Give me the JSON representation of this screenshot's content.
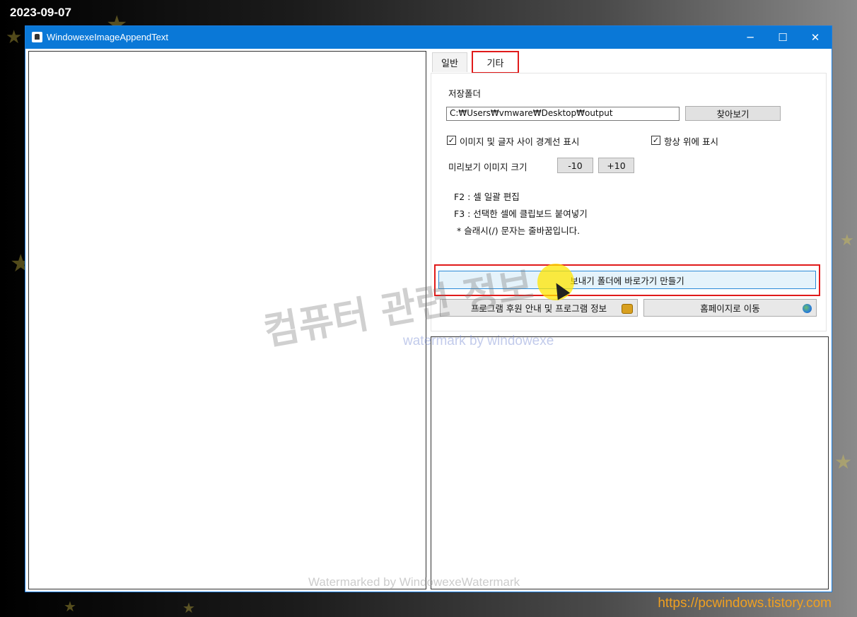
{
  "capture": {
    "date": "2023-09-07",
    "site": "https://pcwindows.tistory.com"
  },
  "window": {
    "title": "WindowexeImageAppendText",
    "controls": {
      "minimize": "─",
      "maximize": "☐",
      "close": "✕"
    }
  },
  "tabs": [
    {
      "label": "일반",
      "active": false
    },
    {
      "label": "기타",
      "active": true
    }
  ],
  "settings": {
    "save_folder_label": "저장폴더",
    "save_folder_value": "C:₩Users₩vmware₩Desktop₩output",
    "browse_button": "찾아보기",
    "border_checkbox": {
      "label": "이미지 및 글자 사이 경계선 표시",
      "checked": true
    },
    "topmost_checkbox": {
      "label": "항상 위에 표시",
      "checked": true
    },
    "preview_size_label": "미리보기 이미지 크기",
    "decrease_button": "-10",
    "increase_button": "+10",
    "help_lines": [
      "F2 : 셀 일괄 편집",
      "F3 : 선택한 셀에 클립보드 붙여넣기",
      "* 슬래시(/) 문자는 줄바꿈입니다."
    ],
    "shortcut_button": "보내기 폴더에 바로가기 만들기",
    "sponsor_button": "프로그램 후원 안내 및 프로그램 정보",
    "homepage_button": "홈페이지로 이동"
  },
  "watermarks": {
    "center": "컴퓨터 관련 정보",
    "center_sub": "watermark by windowexe",
    "bottom": "Watermarked by WindowexeWatermark"
  },
  "icons": {
    "app": "app-icon",
    "sponsor": "coins-icon",
    "homepage": "globe-icon",
    "cursor": "mouse-cursor-icon"
  },
  "colors": {
    "titlebar": "#0a78d7",
    "highlight": "#e01a1a",
    "selected_button": "#e5f3fb",
    "link": "#f0a020"
  }
}
